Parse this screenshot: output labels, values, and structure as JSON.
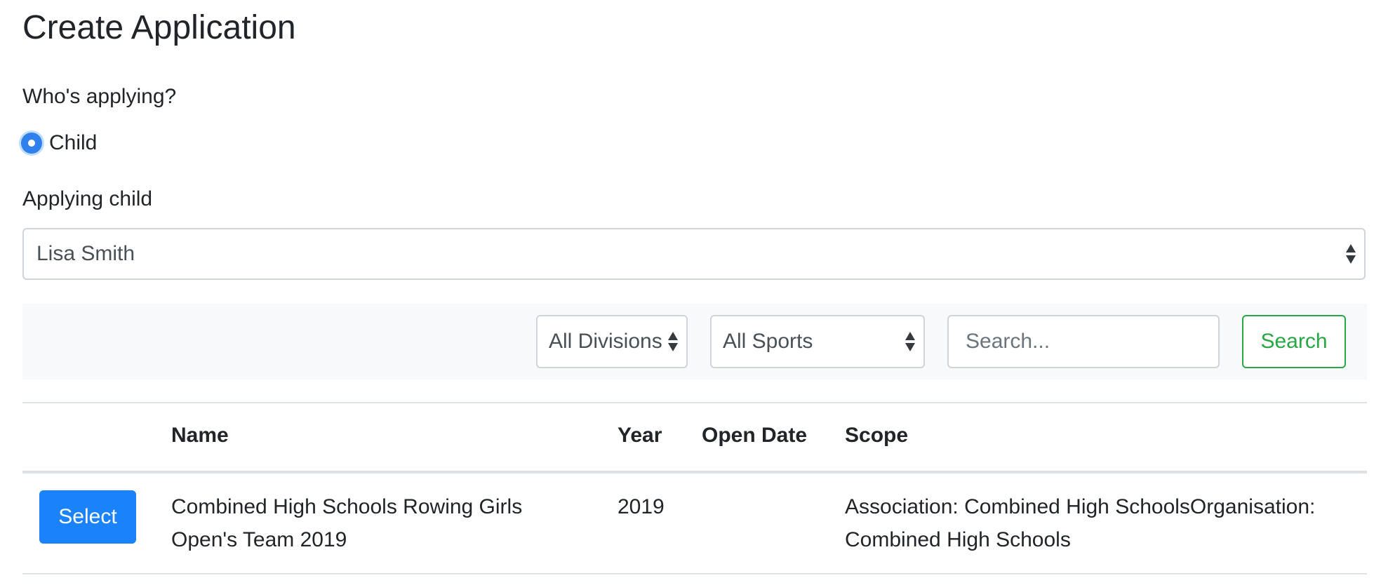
{
  "page": {
    "title": "Create Application"
  },
  "applicant": {
    "question": "Who's applying?",
    "options": [
      {
        "label": "Child",
        "selected": true
      }
    ]
  },
  "child_field": {
    "label": "Applying child",
    "value": "Lisa Smith"
  },
  "filters": {
    "division": "All Divisions",
    "sport": "All Sports",
    "search_placeholder": "Search...",
    "search_value": "",
    "search_button": "Search"
  },
  "table": {
    "headers": {
      "name": "Name",
      "year": "Year",
      "open_date": "Open Date",
      "scope": "Scope"
    },
    "rows": [
      {
        "action": "Select",
        "name": "Combined High Schools Rowing Girls Open's Team 2019",
        "year": "2019",
        "open_date": "",
        "scope": "Association: Combined High SchoolsOrganisation: Combined High Schools"
      }
    ]
  },
  "colors": {
    "primary": "#1a82fb",
    "success": "#28a745",
    "text": "#212529",
    "border": "#ced4da",
    "bar_bg": "#f8f9fa"
  }
}
